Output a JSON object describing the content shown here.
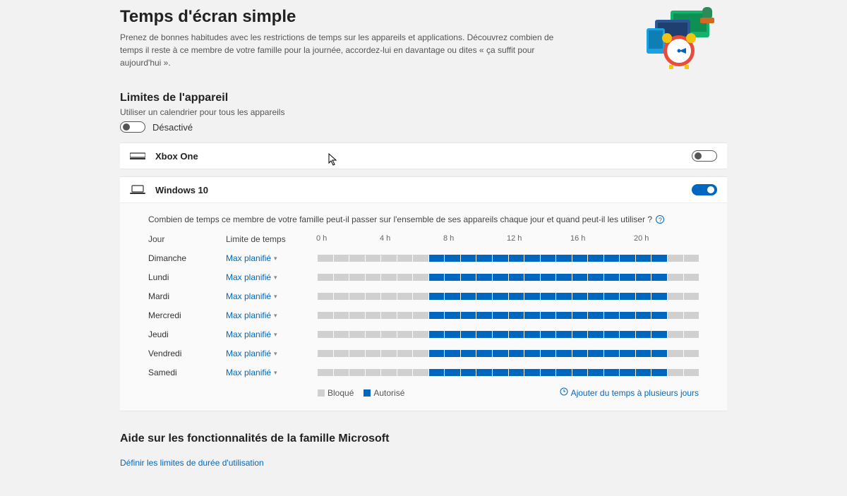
{
  "header": {
    "title": "Temps d'écran simple",
    "subtitle": "Prenez de bonnes habitudes avec les restrictions de temps sur les appareils et applications. Découvrez combien de temps il reste à ce membre de votre famille pour la journée, accordez-lui en davantage ou dites « ça suffit pour aujourd'hui »."
  },
  "limits": {
    "title": "Limites de l'appareil",
    "subtitle": "Utiliser un calendrier pour tous les appareils",
    "global_toggle_label": "Désactivé",
    "global_toggle_on": false
  },
  "devices": [
    {
      "name": "Xbox One",
      "icon": "console-icon",
      "enabled": false
    },
    {
      "name": "Windows 10",
      "icon": "laptop-icon",
      "enabled": true
    }
  ],
  "schedule": {
    "intro": "Combien de temps ce membre de votre famille peut-il passer sur l'ensemble de ses appareils chaque jour et quand peut-il les utiliser ?",
    "col_day": "Jour",
    "col_limit": "Limite de temps",
    "axis": [
      "0 h",
      "4 h",
      "8 h",
      "12 h",
      "16 h",
      "20 h"
    ],
    "hours_total": 24,
    "limit_label": "Max planifié",
    "days": [
      {
        "name": "Dimanche",
        "allowed": [
          [
            7,
            22
          ]
        ]
      },
      {
        "name": "Lundi",
        "allowed": [
          [
            7,
            22
          ]
        ]
      },
      {
        "name": "Mardi",
        "allowed": [
          [
            7,
            22
          ]
        ]
      },
      {
        "name": "Mercredi",
        "allowed": [
          [
            7,
            22
          ]
        ]
      },
      {
        "name": "Jeudi",
        "allowed": [
          [
            7,
            22
          ]
        ]
      },
      {
        "name": "Vendredi",
        "allowed": [
          [
            7,
            22
          ]
        ]
      },
      {
        "name": "Samedi",
        "allowed": [
          [
            7,
            22
          ]
        ]
      }
    ],
    "legend_blocked": "Bloqué",
    "legend_allowed": "Autorisé",
    "add_time_label": "Ajouter du temps à plusieurs jours"
  },
  "footer": {
    "title": "Aide sur les fonctionnalités de la famille Microsoft",
    "link": "Définir les limites de durée d'utilisation"
  }
}
